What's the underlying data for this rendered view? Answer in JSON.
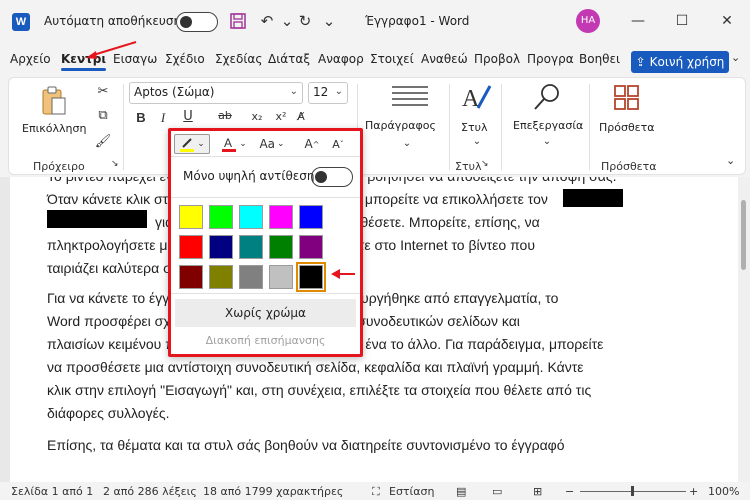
{
  "titlebar": {
    "autosave_label": "Αυτόματη αποθήκευση",
    "doc_title": "Έγγραφο1 - Word",
    "user_initials": "HA",
    "word_logo_letter": "W"
  },
  "tabs": [
    "Αρχείο",
    "Κεντρι",
    "Εισαγω",
    "Σχέδιο",
    "Σχεδίας",
    "Διάταξ",
    "Αναφορ",
    "Στοιχεί",
    "Αναθεώ",
    "Προβολ",
    "Προγρα",
    "Βοηθει"
  ],
  "share_label": "Κοινή χρήση",
  "ribbon": {
    "paste_label": "Επικόλληση",
    "clipboard_label": "Πρόχειρο",
    "font_name": "Aptos (Σώμα)",
    "font_size": "12",
    "paragraph_label": "Παράγραφος",
    "styles_label": "Στυλ",
    "styles_group_label": "Στυλ",
    "editing_label": "Επεξεργασία",
    "addins_label": "Πρόσθετα",
    "addins_group_label": "Πρόσθετα",
    "bold": "B",
    "italic": "I"
  },
  "document": {
    "p1_line1": "Το βίντεο παρέχει έναν εξαιρετικό τρόπο για να σας βοηθήσει να αποδείξετε την άποψή σας.",
    "p1_line2": "Όταν κάνετε κλικ στην επιλογή Ηλεκτρονικό βίντεο, μπορείτε να επικολλήσετε τον",
    "p1_line3": "για το βίντεο που θέλετε να προσθέσετε. Μπορείτε, επίσης, να",
    "p1_line4": "πληκτρολογήσετε μια λέξη-κλειδί για να αναζητήσετε στο Internet το βίντεο που",
    "p1_line5": "ταιριάζει καλύτερα στο έγγραφό σας.",
    "p2_line1": "Για να κάνετε το έγγραφό σας να φαίνεται ότι δημιουργήθηκε από επαγγελματία, το",
    "p2_line2": "Word προσφέρει σχέδια κεφαλίδων, υποσέλιδων, συνοδευτικών σελίδων και",
    "p2_line3": "πλαισίων κειμένου που αλληλοσυμπληρώνονται το ένα το άλλο. Για παράδειγμα, μπορείτε",
    "p2_line4": "να προσθέσετε μια αντίστοιχη συνοδευτική σελίδα, κεφαλίδα και πλαϊνή γραμμή. Κάντε",
    "p2_line5": "κλικ στην επιλογή \"Εισαγωγή\" και, στη συνέχεια, επιλέξτε τα στοιχεία που θέλετε από τις",
    "p2_line6": "διάφορες συλλογές.",
    "p3_line1": "Επίσης, τα θέματα και τα στυλ σάς βοηθούν να διατηρείτε συντονισμένο το έγγραφό"
  },
  "popup": {
    "high_contrast_label": "Μόνο υψηλή αντίθεση",
    "no_color_label": "Χωρίς χρώμα",
    "stop_highlight_label": "Διακοπή επισήμανσης",
    "highlight_color": "#ffff00",
    "font_color": "#e5151e",
    "swatches": [
      [
        "#ffff00",
        "#00ff00",
        "#00ffff",
        "#ff00ff",
        "#0000ff"
      ],
      [
        "#ff0000",
        "#000080",
        "#008080",
        "#008000",
        "#800080"
      ],
      [
        "#800000",
        "#808000",
        "#808080",
        "#c0c0c0",
        "#000000"
      ]
    ],
    "selected_swatch": "#000000"
  },
  "status": {
    "page": "Σελίδα 1 από 1",
    "words": "2 από 286 λέξεις",
    "chars": "18 από 1799 χαρακτήρες",
    "focus": "Εστίαση",
    "zoom": "100%"
  },
  "colors": {
    "accent": "#185abd",
    "annotation": "#e5151e"
  }
}
